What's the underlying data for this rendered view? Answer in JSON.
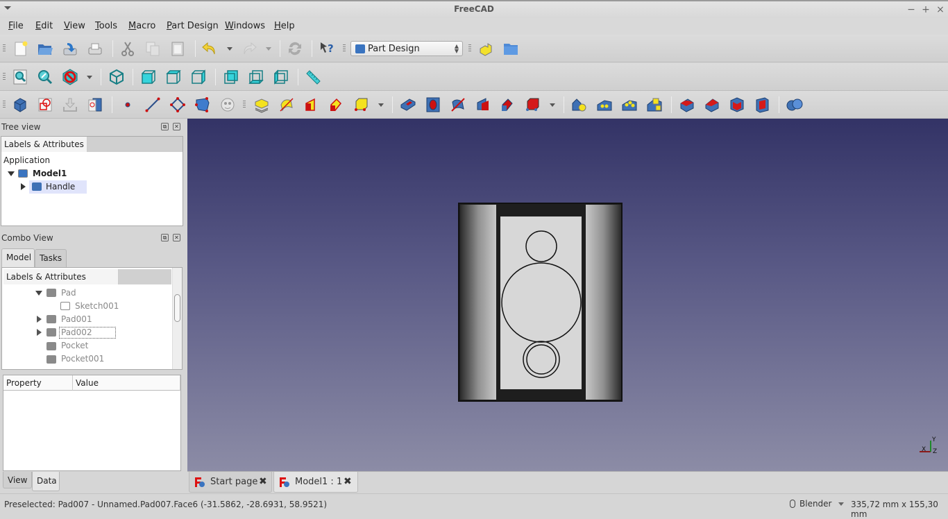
{
  "window": {
    "title": "FreeCAD",
    "minimize": "−",
    "maximize": "+",
    "close": "×"
  },
  "menu": [
    {
      "label": "File",
      "mnemonic": "F",
      "rest": "ile"
    },
    {
      "label": "Edit",
      "mnemonic": "E",
      "rest": "dit"
    },
    {
      "label": "View",
      "mnemonic": "V",
      "rest": "iew"
    },
    {
      "label": "Tools",
      "mnemonic": "T",
      "rest": "ools"
    },
    {
      "label": "Macro",
      "mnemonic": "M",
      "rest": "acro"
    },
    {
      "label": "Part Design",
      "mnemonic": "P",
      "rest": "art Design"
    },
    {
      "label": "Windows",
      "mnemonic": "W",
      "rest": "indows"
    },
    {
      "label": "Help",
      "mnemonic": "H",
      "rest": "elp"
    }
  ],
  "toolbar": {
    "workbench": "Part Design",
    "file_tools": [
      "new-document",
      "open",
      "save",
      "print",
      "cut",
      "copy",
      "paste",
      "undo",
      "redo",
      "refresh",
      "whats-this"
    ],
    "view_tools": [
      "fit-all",
      "fit-selection",
      "draw-style",
      "isometric",
      "front",
      "top",
      "right",
      "rear",
      "bottom",
      "left",
      "measure"
    ],
    "part_design_tools": [
      "create-body",
      "create-sketch",
      "validate-sketch",
      "map-sketch",
      "datum-point",
      "datum-line",
      "datum-plane",
      "local-cs",
      "shape-binder",
      "pad",
      "revolution",
      "additive-loft",
      "additive-pipe",
      "additive-primitive",
      "pocket",
      "hole",
      "groove",
      "subtractive-loft",
      "subtractive-pipe",
      "subtractive-primitive",
      "mirrored",
      "linear-pattern",
      "polar-pattern",
      "multi-transform",
      "fillet",
      "chamfer",
      "draft",
      "thickness",
      "boolean"
    ]
  },
  "tree_view": {
    "title": "Tree view",
    "header": "Labels & Attributes",
    "root": "Application",
    "items": [
      {
        "label": "Model1",
        "expanded": true
      },
      {
        "label": "Handle",
        "expanded": false
      }
    ]
  },
  "combo_view": {
    "title": "Combo View",
    "tabs": [
      "Model",
      "Tasks"
    ],
    "active_tab": "Model",
    "header": "Labels & Attributes",
    "items": [
      {
        "label": "Pad",
        "expander": "down"
      },
      {
        "label": "Sketch001",
        "expander": "none"
      },
      {
        "label": "Pad001",
        "expander": "right"
      },
      {
        "label": "Pad002",
        "expander": "right"
      },
      {
        "label": "Pocket",
        "expander": "none"
      },
      {
        "label": "Pocket001",
        "expander": "none"
      }
    ],
    "property_columns": [
      "Property",
      "Value"
    ],
    "bottom_tabs": [
      "View",
      "Data"
    ],
    "active_bottom_tab": "Data"
  },
  "document_tabs": [
    {
      "label": "Start page"
    },
    {
      "label": "Model1 : 1",
      "active": true
    }
  ],
  "axis": {
    "x": "X",
    "y": "Y",
    "z": "Z"
  },
  "status": {
    "message": "Preselected: Pad007 - Unnamed.Pad007.Face6 (-31.5862, -28.6931, 58.9521)",
    "navigation_style": "Blender",
    "dimensions": "335,72 mm x 155,30 mm"
  }
}
